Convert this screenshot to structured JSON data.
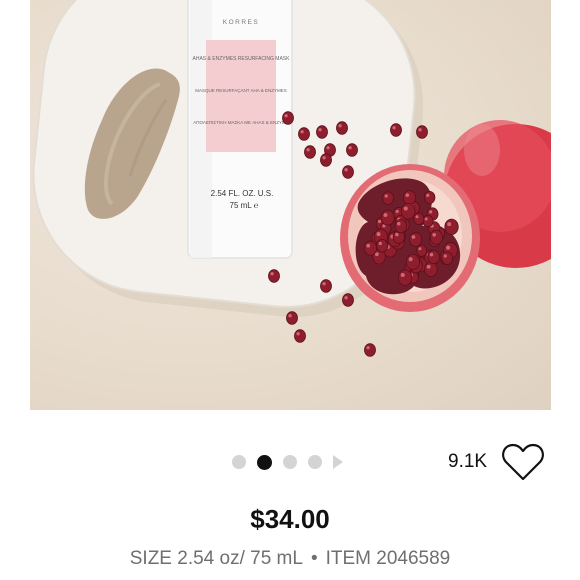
{
  "product_image": {
    "brand": "KORRES",
    "label_en": "AHAS & ENZYMES RESURFACING MASK",
    "label_fr": "MASQUE RESURFAÇANT AHA & ENZYMES",
    "label_gr": "ΑΠΟΛΕΠΙΣΤΙΚΗ ΜΑΣΚΑ ΜΕ AHAS & ENZYMA",
    "size_line1": "2.54 FL. OZ. U.S.",
    "size_line2": "75 mL ℮"
  },
  "carousel": {
    "total": 5,
    "active_index": 1,
    "next_icon": "chevron-right-icon"
  },
  "likes": {
    "count": "9.1K",
    "icon": "heart-outline-icon"
  },
  "price": "$34.00",
  "details": {
    "size": "SIZE 2.54 oz/ 75 mL",
    "separator": "•",
    "item": "ITEM 2046589"
  },
  "colors": {
    "text": "#111111",
    "muted": "#6f6f6f",
    "dot_inactive": "#d4d4d4",
    "label_pink": "#f4cdd0"
  }
}
